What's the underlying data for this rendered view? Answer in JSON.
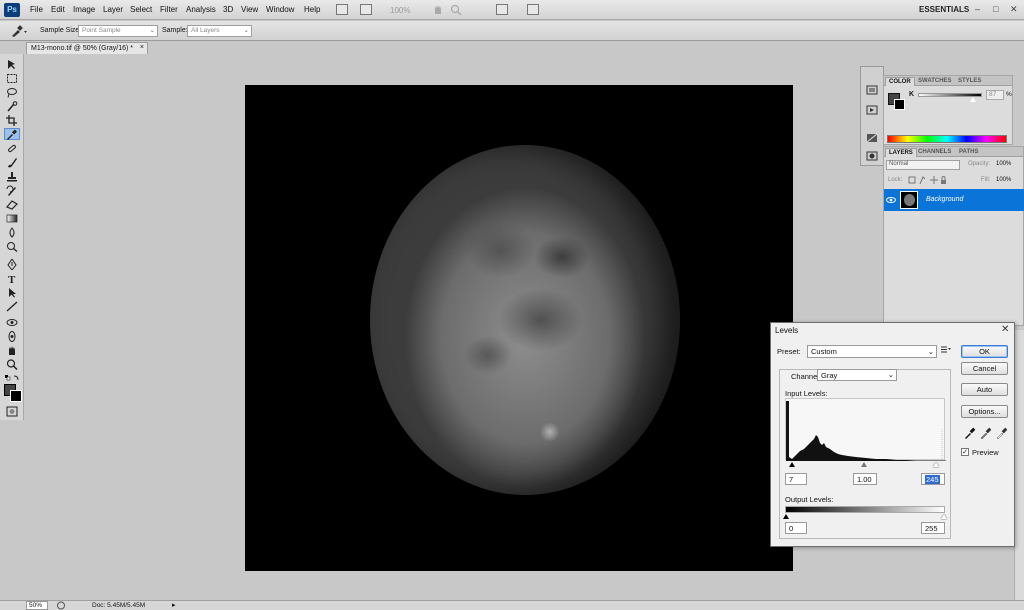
{
  "app": {
    "logo_text": "Ps",
    "workspace": "ESSENTIALS",
    "zoom_level": "100%"
  },
  "menu": [
    "File",
    "Edit",
    "Image",
    "Layer",
    "Select",
    "Filter",
    "Analysis",
    "3D",
    "View",
    "Window",
    "Help"
  ],
  "options_bar": {
    "sample_size_label": "Sample Size:",
    "sample_size_value": "Point Sample",
    "sample_label": "Sample:",
    "sample_value": "All Layers"
  },
  "document": {
    "tab_title": "M13-mono.tif @ 50% (Gray/16) *",
    "close_glyph": "×"
  },
  "status": {
    "zoom": "50%",
    "doc_info": "Doc: 5.45M/5.45M"
  },
  "color_panel": {
    "tabs": [
      "COLOR",
      "SWATCHES",
      "STYLES"
    ],
    "channel_label": "K",
    "k_value": "87",
    "k_unit": "%"
  },
  "layers_panel": {
    "tabs": [
      "LAYERS",
      "CHANNELS",
      "PATHS"
    ],
    "blend_mode": "Normal",
    "opacity_label": "Opacity:",
    "opacity_value": "100%",
    "lock_label": "Lock:",
    "fill_label": "Fill:",
    "fill_value": "100%",
    "layer_name": "Background"
  },
  "levels_dialog": {
    "title": "Levels",
    "close_glyph": "✕",
    "preset_label": "Preset:",
    "preset_value": "Custom",
    "channel_label": "Channel:",
    "channel_value": "Gray",
    "input_levels_label": "Input Levels:",
    "input_black": "7",
    "input_gamma": "1.00",
    "input_white": "245",
    "output_levels_label": "Output Levels:",
    "output_black": "0",
    "output_white": "255",
    "buttons": {
      "ok": "OK",
      "cancel": "Cancel",
      "auto": "Auto",
      "options": "Options..."
    },
    "preview_label": "Preview",
    "preview_checked": true
  }
}
